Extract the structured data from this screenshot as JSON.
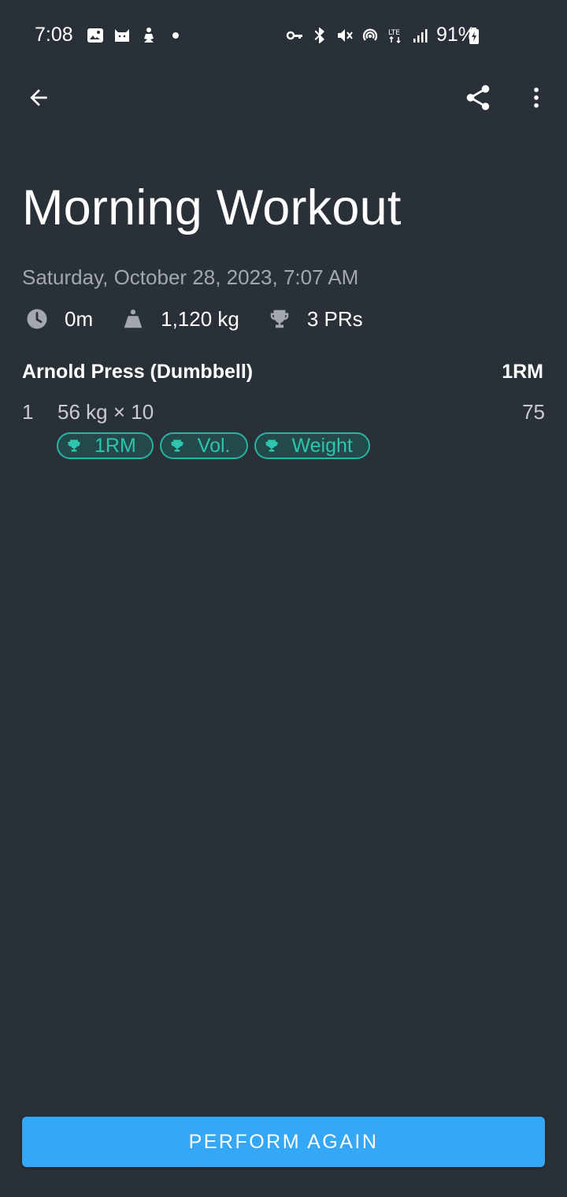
{
  "status_bar": {
    "time": "7:08",
    "battery_percent": "91%",
    "network": "LTE",
    "colors": {
      "text": "#ffffff"
    }
  },
  "app_bar": {
    "back_icon": "arrow-left-icon",
    "share_icon": "share-icon",
    "more_icon": "more-vert-icon"
  },
  "workout": {
    "title": "Morning Workout",
    "date": "Saturday, October 28, 2023, 7:07 AM",
    "stats": {
      "duration": "0m",
      "volume": "1,120 kg",
      "prs": "3 PRs"
    }
  },
  "exercises": [
    {
      "name": "Arnold Press (Dumbbell)",
      "column_header": "1RM",
      "sets": [
        {
          "number": "1",
          "detail": "56 kg × 10",
          "value": "75",
          "badges": [
            "1RM",
            "Vol.",
            "Weight"
          ]
        }
      ]
    }
  ],
  "actions": {
    "perform_again": "PERFORM AGAIN"
  },
  "colors": {
    "background": "#2a3038",
    "accent": "#35a7f7",
    "badge": "#2fc4ad",
    "muted": "#a3a8ae"
  }
}
